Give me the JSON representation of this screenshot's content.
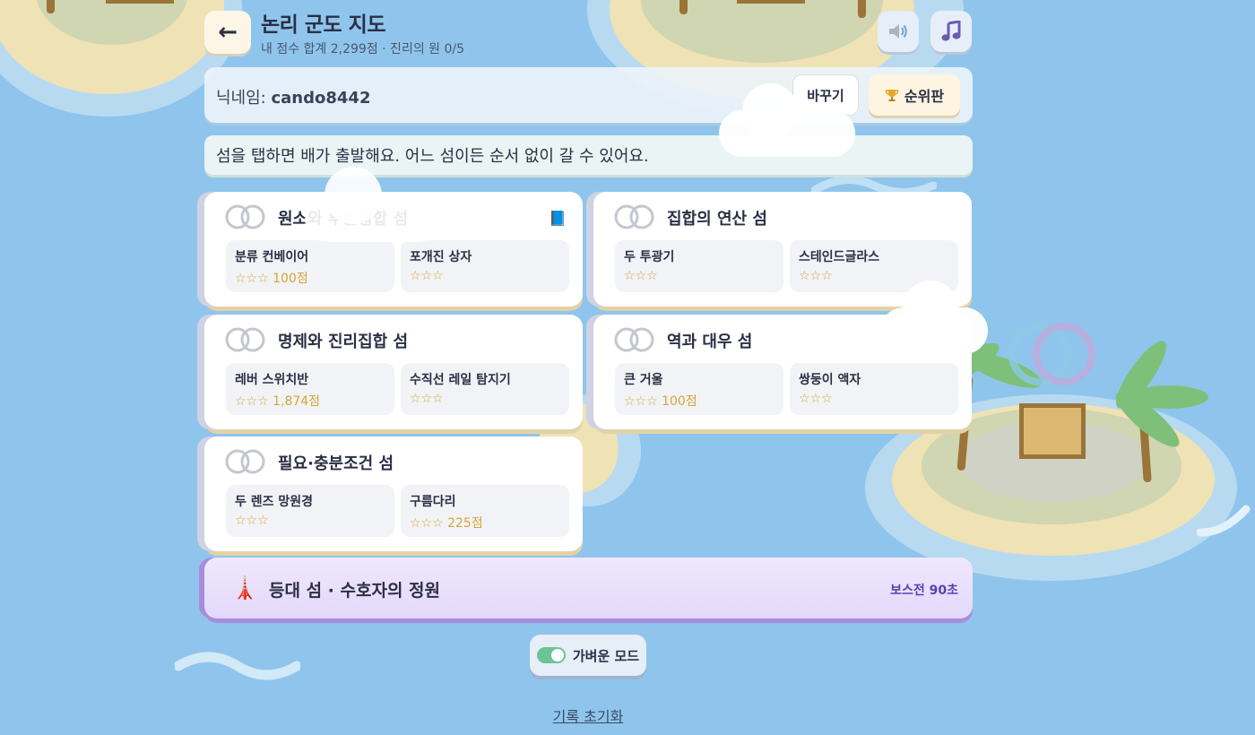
{
  "header": {
    "back_icon": "arrow-left-icon",
    "title": "논리 군도 지도",
    "subtitle": "내 점수 합계 2,299점 · 진리의 원 0/5",
    "sound_icon": "speaker-icon",
    "music_icon": "music-note-icon"
  },
  "nickname": {
    "label": "닉네임:",
    "value": "cando8442",
    "change_label": "바꾸기",
    "leaderboard_label": "순위판",
    "leaderboard_icon": "trophy-icon"
  },
  "hint": "섬을 탭하면 배가 출발해요. 어느 섬이든 순서 없이 갈 수 있어요.",
  "islands": [
    {
      "title": "원소와 부분집합 섬",
      "levels": [
        {
          "name": "분류 컨베이어",
          "score": "☆☆☆ 100점"
        },
        {
          "name": "포개진 상자",
          "score": "☆☆☆"
        }
      ]
    },
    {
      "title": "집합의 연산 섬",
      "levels": [
        {
          "name": "두 투광기",
          "score": "☆☆☆"
        },
        {
          "name": "스테인드글라스",
          "score": "☆☆☆"
        }
      ]
    },
    {
      "title": "명제와 진리집합 섬",
      "levels": [
        {
          "name": "레버 스위치반",
          "score": "☆☆☆ 1,874점"
        },
        {
          "name": "수직선 레일 탐지기",
          "score": "☆☆☆"
        }
      ]
    },
    {
      "title": "역과 대우 섬",
      "levels": [
        {
          "name": "큰 거울",
          "score": "☆☆☆ 100점"
        },
        {
          "name": "쌍둥이 액자",
          "score": "☆☆☆"
        }
      ]
    },
    {
      "title": "필요·충분조건 섬",
      "levels": [
        {
          "name": "두 렌즈 망원경",
          "score": "☆☆☆"
        },
        {
          "name": "구름다리",
          "score": "☆☆☆ 225점"
        }
      ]
    }
  ],
  "boss": {
    "icon": "tower-icon",
    "title": "등대 섬 · 수호자의 정원",
    "tag": "보스전 90초"
  },
  "light_mode": {
    "label": "가벼운 모드",
    "enabled": true
  },
  "reset_label": "기록 초기화",
  "colors": {
    "background": "#8fc5ec",
    "star": "#d2a63a",
    "boss_accent": "#a88cdc",
    "toggle_on": "#6bc497"
  }
}
